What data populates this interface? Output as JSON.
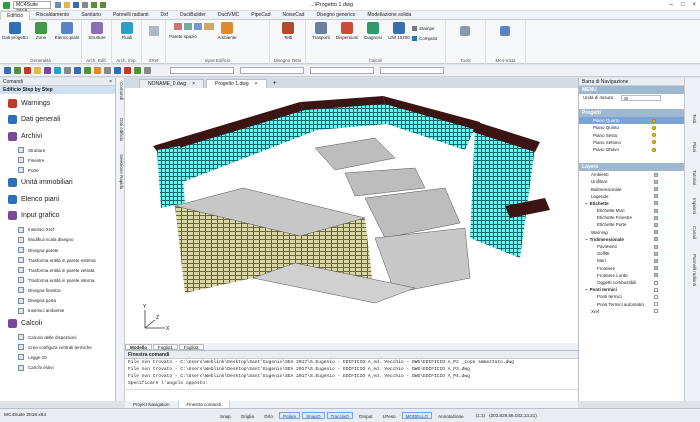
{
  "window": {
    "app_select": "MC4Suite 2018",
    "title": "...\\Progetto 1.dwg"
  },
  "ribbon_tabs": [
    "Edificio",
    "Riscaldamento",
    "Sanitario",
    "Pannelli radianti",
    "Dxf",
    "DuctBuilder",
    "DuctVMC",
    "PipeCad",
    "NoiseCad",
    "Disegno generico",
    "Modellazione solida"
  ],
  "ribbon_active": 0,
  "ribbon_groups": [
    {
      "label": "Generalità",
      "buttons": [
        "Dati progetto",
        "Zone",
        "Elenco piani"
      ]
    },
    {
      "label": "Arch. Edif.",
      "buttons": [
        "Strutture"
      ]
    },
    {
      "label": "Arch. Imp.",
      "buttons": [
        "Fluidi"
      ]
    },
    {
      "label": "XRef",
      "buttons": []
    },
    {
      "label": "Input Edificio",
      "buttons": [
        "Parete spazio",
        "Ambiente"
      ]
    },
    {
      "label": "Disegno Tetto",
      "buttons": [
        "Tetti"
      ]
    },
    {
      "label": "Calcoli",
      "buttons": [
        "Trasporti",
        "Dispersioni",
        "Diagnosi",
        "UNI 10200",
        "Stampe",
        "Computo"
      ]
    },
    {
      "label": "Tools",
      "buttons": []
    },
    {
      "label": "Mc4-Vista",
      "buttons": []
    }
  ],
  "left_panel": {
    "header": "Comandi",
    "subheader": "Edificio Step by Step",
    "sections": [
      {
        "label": "Warnings",
        "type": "main",
        "color": "#c0392b"
      },
      {
        "label": "Dati generali",
        "type": "main",
        "color": "#2e6fb8"
      },
      {
        "label": "Archivi",
        "type": "main",
        "color": "#7a4a9a"
      },
      {
        "label": "Strutture",
        "type": "sub"
      },
      {
        "label": "Finestre",
        "type": "sub"
      },
      {
        "label": "Porte",
        "type": "sub"
      },
      {
        "label": "Unità immobiliari",
        "type": "main",
        "color": "#2e6fb8"
      },
      {
        "label": "Elenco piani",
        "type": "main",
        "color": "#2e6fb8"
      },
      {
        "label": "Input grafico",
        "type": "main",
        "color": "#7a4a9a"
      },
      {
        "label": "Inserisci Xref",
        "type": "sub"
      },
      {
        "label": "Modifica scala disegno",
        "type": "sub"
      },
      {
        "label": "Disegna parete",
        "type": "sub"
      },
      {
        "label": "Trasforma entità in parete esterna",
        "type": "sub"
      },
      {
        "label": "Trasforma entità in parete vetrata",
        "type": "sub"
      },
      {
        "label": "Trasforma entità in parete interna",
        "type": "sub"
      },
      {
        "label": "Disegna finestra",
        "type": "sub"
      },
      {
        "label": "Disegna porta",
        "type": "sub"
      },
      {
        "label": "Inserisci ambiente",
        "type": "sub"
      },
      {
        "label": "Calcoli",
        "type": "main",
        "color": "#7a4a9a"
      },
      {
        "label": "Calcolo delle dispersioni",
        "type": "sub"
      },
      {
        "label": "Crea configura centrali termiche",
        "type": "sub"
      },
      {
        "label": "Legge 10",
        "type": "sub"
      },
      {
        "label": "Carichi estivi",
        "type": "sub"
      }
    ]
  },
  "left_vtabs": [
    "Comandi",
    "Dati edificio",
    "Selezione Rapida"
  ],
  "doc_tabs": [
    "NONAME_0.dwg",
    "Progetto 1.dwg"
  ],
  "view_tabs": [
    "Modello",
    "Foglio1",
    "Foglio2"
  ],
  "command": {
    "header": "Finestra comandi",
    "lines": [
      "File non trovato - C:\\Users\\Weblink\\Desktop\\Sant'Eugenio\\SEA 2017\\S.Eugenio - EDIFICIO A_ed. Vecchio - DWG\\EDIFICIO A_P2 _copn ammezzato.dwg",
      "File non trovato - C:\\Users\\Weblink\\Desktop\\Sant'Eugenio\\SEA 2017\\S.Eugenio - EDIFICIO A_ed. Vecchio - DWG\\EDIFICIO A_P3.dwg",
      "File non trovato - C:\\Users\\Weblink\\Desktop\\Sant'Eugenio\\SEA 2017\\S.Eugenio - EDIFICIO A_ed. Vecchio - DWG\\EDIFICIO A_P4.dwg",
      "Specificare l'angolo opposto:"
    ]
  },
  "bottom_tabs": [
    "Project Navigation",
    "Finestra comandi"
  ],
  "right_panel": {
    "header": "Barra di Navigazione",
    "menu_label": "MENU",
    "unit_label": "Unità di misura",
    "unit_value": "SI",
    "projects_header": "Progetti",
    "floors": [
      "Piano Quarto",
      "Piano Quinto",
      "Piano Sesto",
      "Piano Settimo",
      "Piano Ottavo"
    ],
    "layers_header": "Layers",
    "layers": [
      {
        "label": "Ambienti",
        "level": 1,
        "checked": true
      },
      {
        "label": "Unifilare",
        "level": 1,
        "checked": true
      },
      {
        "label": "Bidimensionale",
        "level": 1,
        "checked": true
      },
      {
        "label": "Legende",
        "level": 1,
        "checked": true
      },
      {
        "label": "Etichette",
        "level": 0,
        "checked": true
      },
      {
        "label": "Etichette Muri",
        "level": 2,
        "checked": true
      },
      {
        "label": "Etichette Finestre",
        "level": 2,
        "checked": true
      },
      {
        "label": "Etichette Porte",
        "level": 2,
        "checked": true
      },
      {
        "label": "Warning",
        "level": 1,
        "checked": true
      },
      {
        "label": "Tridimensionale",
        "level": 0,
        "checked": true
      },
      {
        "label": "Pavimenti",
        "level": 2,
        "checked": true
      },
      {
        "label": "Soffitti",
        "level": 2,
        "checked": true
      },
      {
        "label": "Muri",
        "level": 2,
        "checked": true
      },
      {
        "label": "Frontiere",
        "level": 2,
        "checked": true
      },
      {
        "label": "Frontiere Lorde",
        "level": 2,
        "checked": true
      },
      {
        "label": "Oggetti combustibili",
        "level": 2,
        "checked": false
      },
      {
        "label": "Ponti termici",
        "level": 0,
        "checked": false
      },
      {
        "label": "Ponti termici",
        "level": 2,
        "checked": false
      },
      {
        "label": "Ponti Termici automatici",
        "level": 2,
        "checked": false
      },
      {
        "label": "Xref",
        "level": 1,
        "checked": false
      }
    ]
  },
  "right_vtabs": [
    "Testi",
    "Piani",
    "Tutorial",
    "Impianti",
    "Canali",
    "Pannelli radianti"
  ],
  "status": {
    "app": "MC4Suite 2018 x64",
    "buttons": [
      {
        "label": "Snap",
        "on": false
      },
      {
        "label": "Griglia",
        "on": false
      },
      {
        "label": "Orto",
        "on": false
      },
      {
        "label": "Polare",
        "on": true
      },
      {
        "label": "SnapO",
        "on": true
      },
      {
        "label": "TracciaO",
        "on": true
      },
      {
        "label": "DInput",
        "on": false
      },
      {
        "label": "LPeso",
        "on": false
      },
      {
        "label": "MODELLO",
        "on": true
      },
      {
        "label": "Annotazione",
        "on": false
      }
    ],
    "scale": "(1:1)",
    "coords": "(203.829,66.032,13.21)"
  },
  "colors": {
    "accent": "#2e6fb8",
    "building_wall": "#6ff2ef",
    "building_slab": "#d9d6a8",
    "roof": "#3b1414"
  }
}
